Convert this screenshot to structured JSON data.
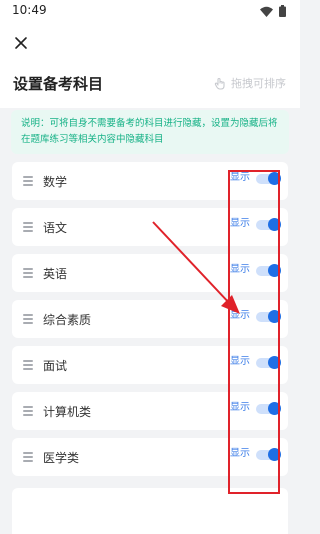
{
  "status_bar": {
    "time": "10:49"
  },
  "header": {
    "title": "设置备考科目",
    "drag_sort_label": "拖拽可排序"
  },
  "notice": {
    "text": "说明：可将自身不需要备考的科目进行隐藏，设置为隐藏后将在题库练习等相关内容中隐藏科目"
  },
  "subjects": [
    {
      "label": "数学",
      "state": "显示",
      "enabled": true
    },
    {
      "label": "语文",
      "state": "显示",
      "enabled": true
    },
    {
      "label": "英语",
      "state": "显示",
      "enabled": true
    },
    {
      "label": "综合素质",
      "state": "显示",
      "enabled": true
    },
    {
      "label": "面试",
      "state": "显示",
      "enabled": true
    },
    {
      "label": "计算机类",
      "state": "显示",
      "enabled": true
    },
    {
      "label": "医学类",
      "state": "显示",
      "enabled": true
    }
  ],
  "colors": {
    "accent": "#1f6fe5",
    "notice_text": "#17b287",
    "notice_bg": "#e9f8f3",
    "annotation_red": "#e0222a"
  }
}
